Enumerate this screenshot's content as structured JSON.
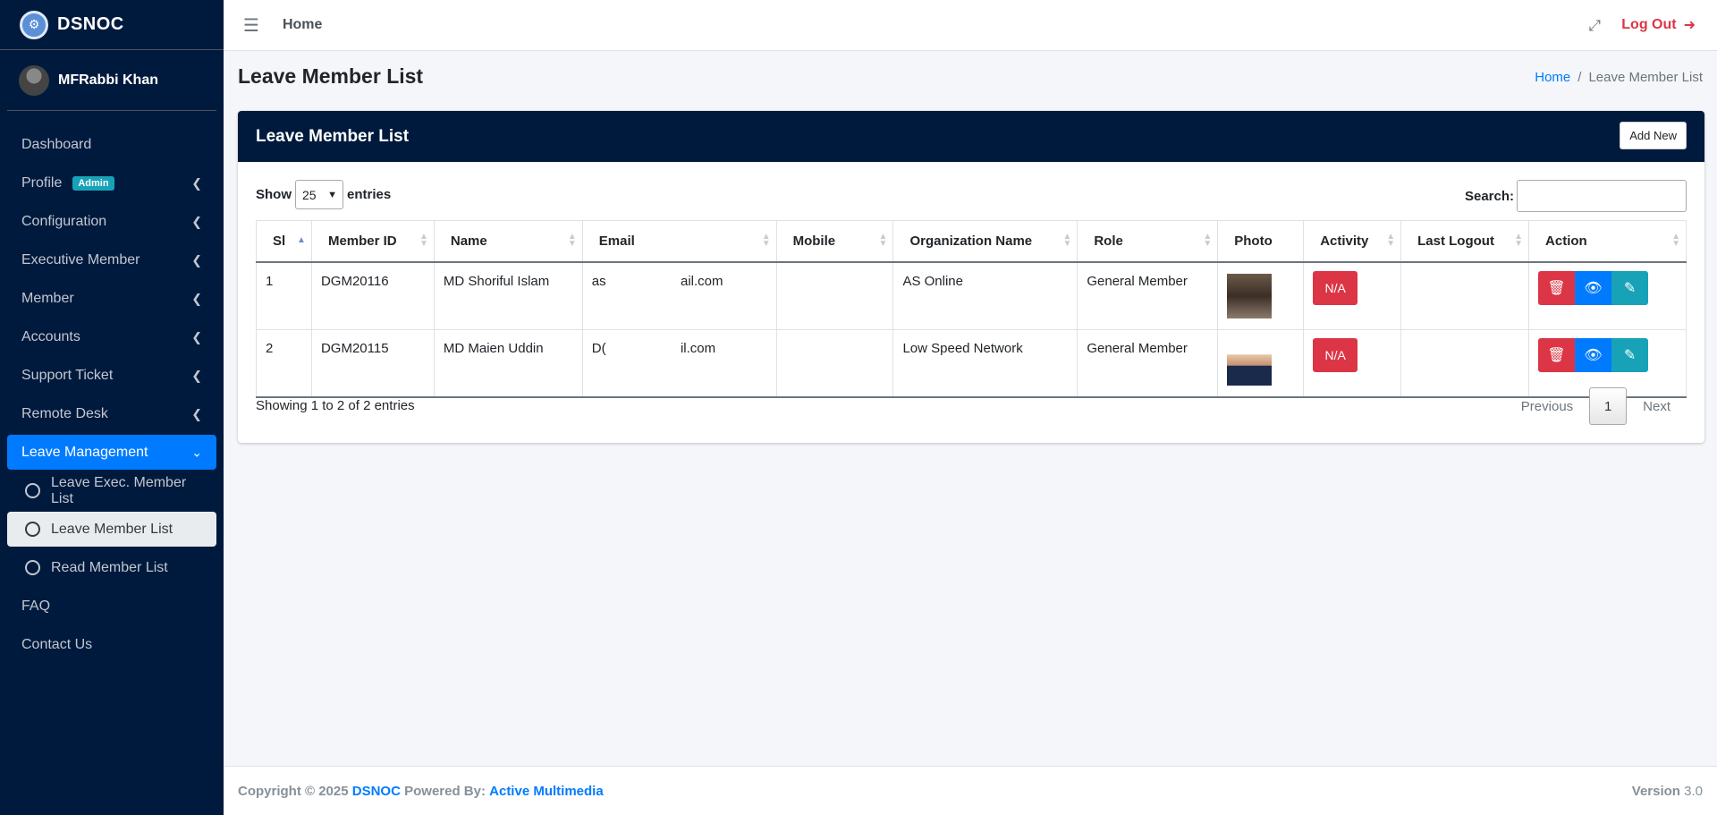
{
  "brand": {
    "name": "DSNOC"
  },
  "user": {
    "name": "MFRabbi Khan"
  },
  "sidebar": {
    "items": [
      {
        "label": "Dashboard"
      },
      {
        "label": "Profile",
        "badge": "Admin"
      },
      {
        "label": "Configuration"
      },
      {
        "label": "Executive Member"
      },
      {
        "label": "Member"
      },
      {
        "label": "Accounts"
      },
      {
        "label": "Support Ticket"
      },
      {
        "label": "Remote Desk"
      },
      {
        "label": "Leave Management"
      },
      {
        "label": "FAQ"
      },
      {
        "label": "Contact Us"
      }
    ],
    "sub_items": [
      {
        "label": "Leave Exec. Member List"
      },
      {
        "label": "Leave Member List"
      },
      {
        "label": "Read Member List"
      }
    ]
  },
  "topbar": {
    "home": "Home",
    "logout": "Log Out"
  },
  "page": {
    "title": "Leave Member List"
  },
  "breadcrumb": {
    "home": "Home",
    "separator": "/",
    "current": "Leave Member List"
  },
  "card": {
    "title": "Leave Member List",
    "add_new": "Add New"
  },
  "controls": {
    "show": "Show",
    "length_value": "25",
    "entries": "entries",
    "search_label": "Search:"
  },
  "table": {
    "headers": [
      "Sl",
      "Member ID",
      "Name",
      "Email",
      "Mobile",
      "Organization Name",
      "Role",
      "Photo",
      "Activity",
      "Last Logout",
      "Action"
    ],
    "rows": [
      {
        "sl": "1",
        "member_id": "DGM20116",
        "name": "MD Shoriful Islam",
        "email": "as                    ail.com",
        "mobile": "",
        "org": "AS Online",
        "role": "General Member",
        "activity": "N/A",
        "last_logout": ""
      },
      {
        "sl": "2",
        "member_id": "DGM20115",
        "name": "MD Maien Uddin",
        "email": "D(                    il.com",
        "mobile": "",
        "org": "Low Speed Network",
        "role": "General Member",
        "activity": "N/A",
        "last_logout": ""
      }
    ]
  },
  "info": "Showing 1 to 2 of 2 entries",
  "pager": {
    "previous": "Previous",
    "current": "1",
    "next": "Next"
  },
  "footer": {
    "copyright": "Copyright © 2025",
    "brand": "DSNOC",
    "powered": "Powered By:",
    "company": "Active Multimedia",
    "version_label": "Version",
    "version": "3.0"
  }
}
